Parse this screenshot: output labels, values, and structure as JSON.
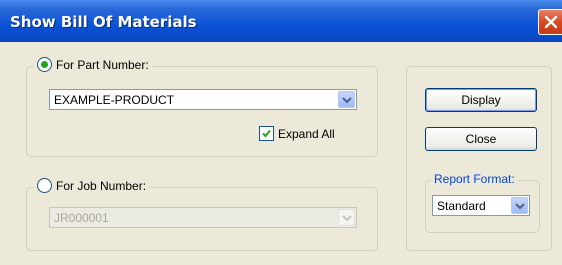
{
  "window": {
    "title": "Show Bill Of Materials"
  },
  "part_group": {
    "radio_label": "For Part Number:",
    "selected": true,
    "part_number": "EXAMPLE-PRODUCT",
    "expand_all_label": "Expand All",
    "expand_all_checked": true
  },
  "job_group": {
    "radio_label": "For Job Number:",
    "selected": false,
    "job_number": "JR000001"
  },
  "buttons": {
    "display": "Display",
    "close": "Close"
  },
  "report_format": {
    "label": "Report Format:",
    "value": "Standard"
  },
  "icons": {
    "close": "close-icon",
    "dropdown": "chevron-down-icon",
    "check": "checkmark-icon"
  }
}
